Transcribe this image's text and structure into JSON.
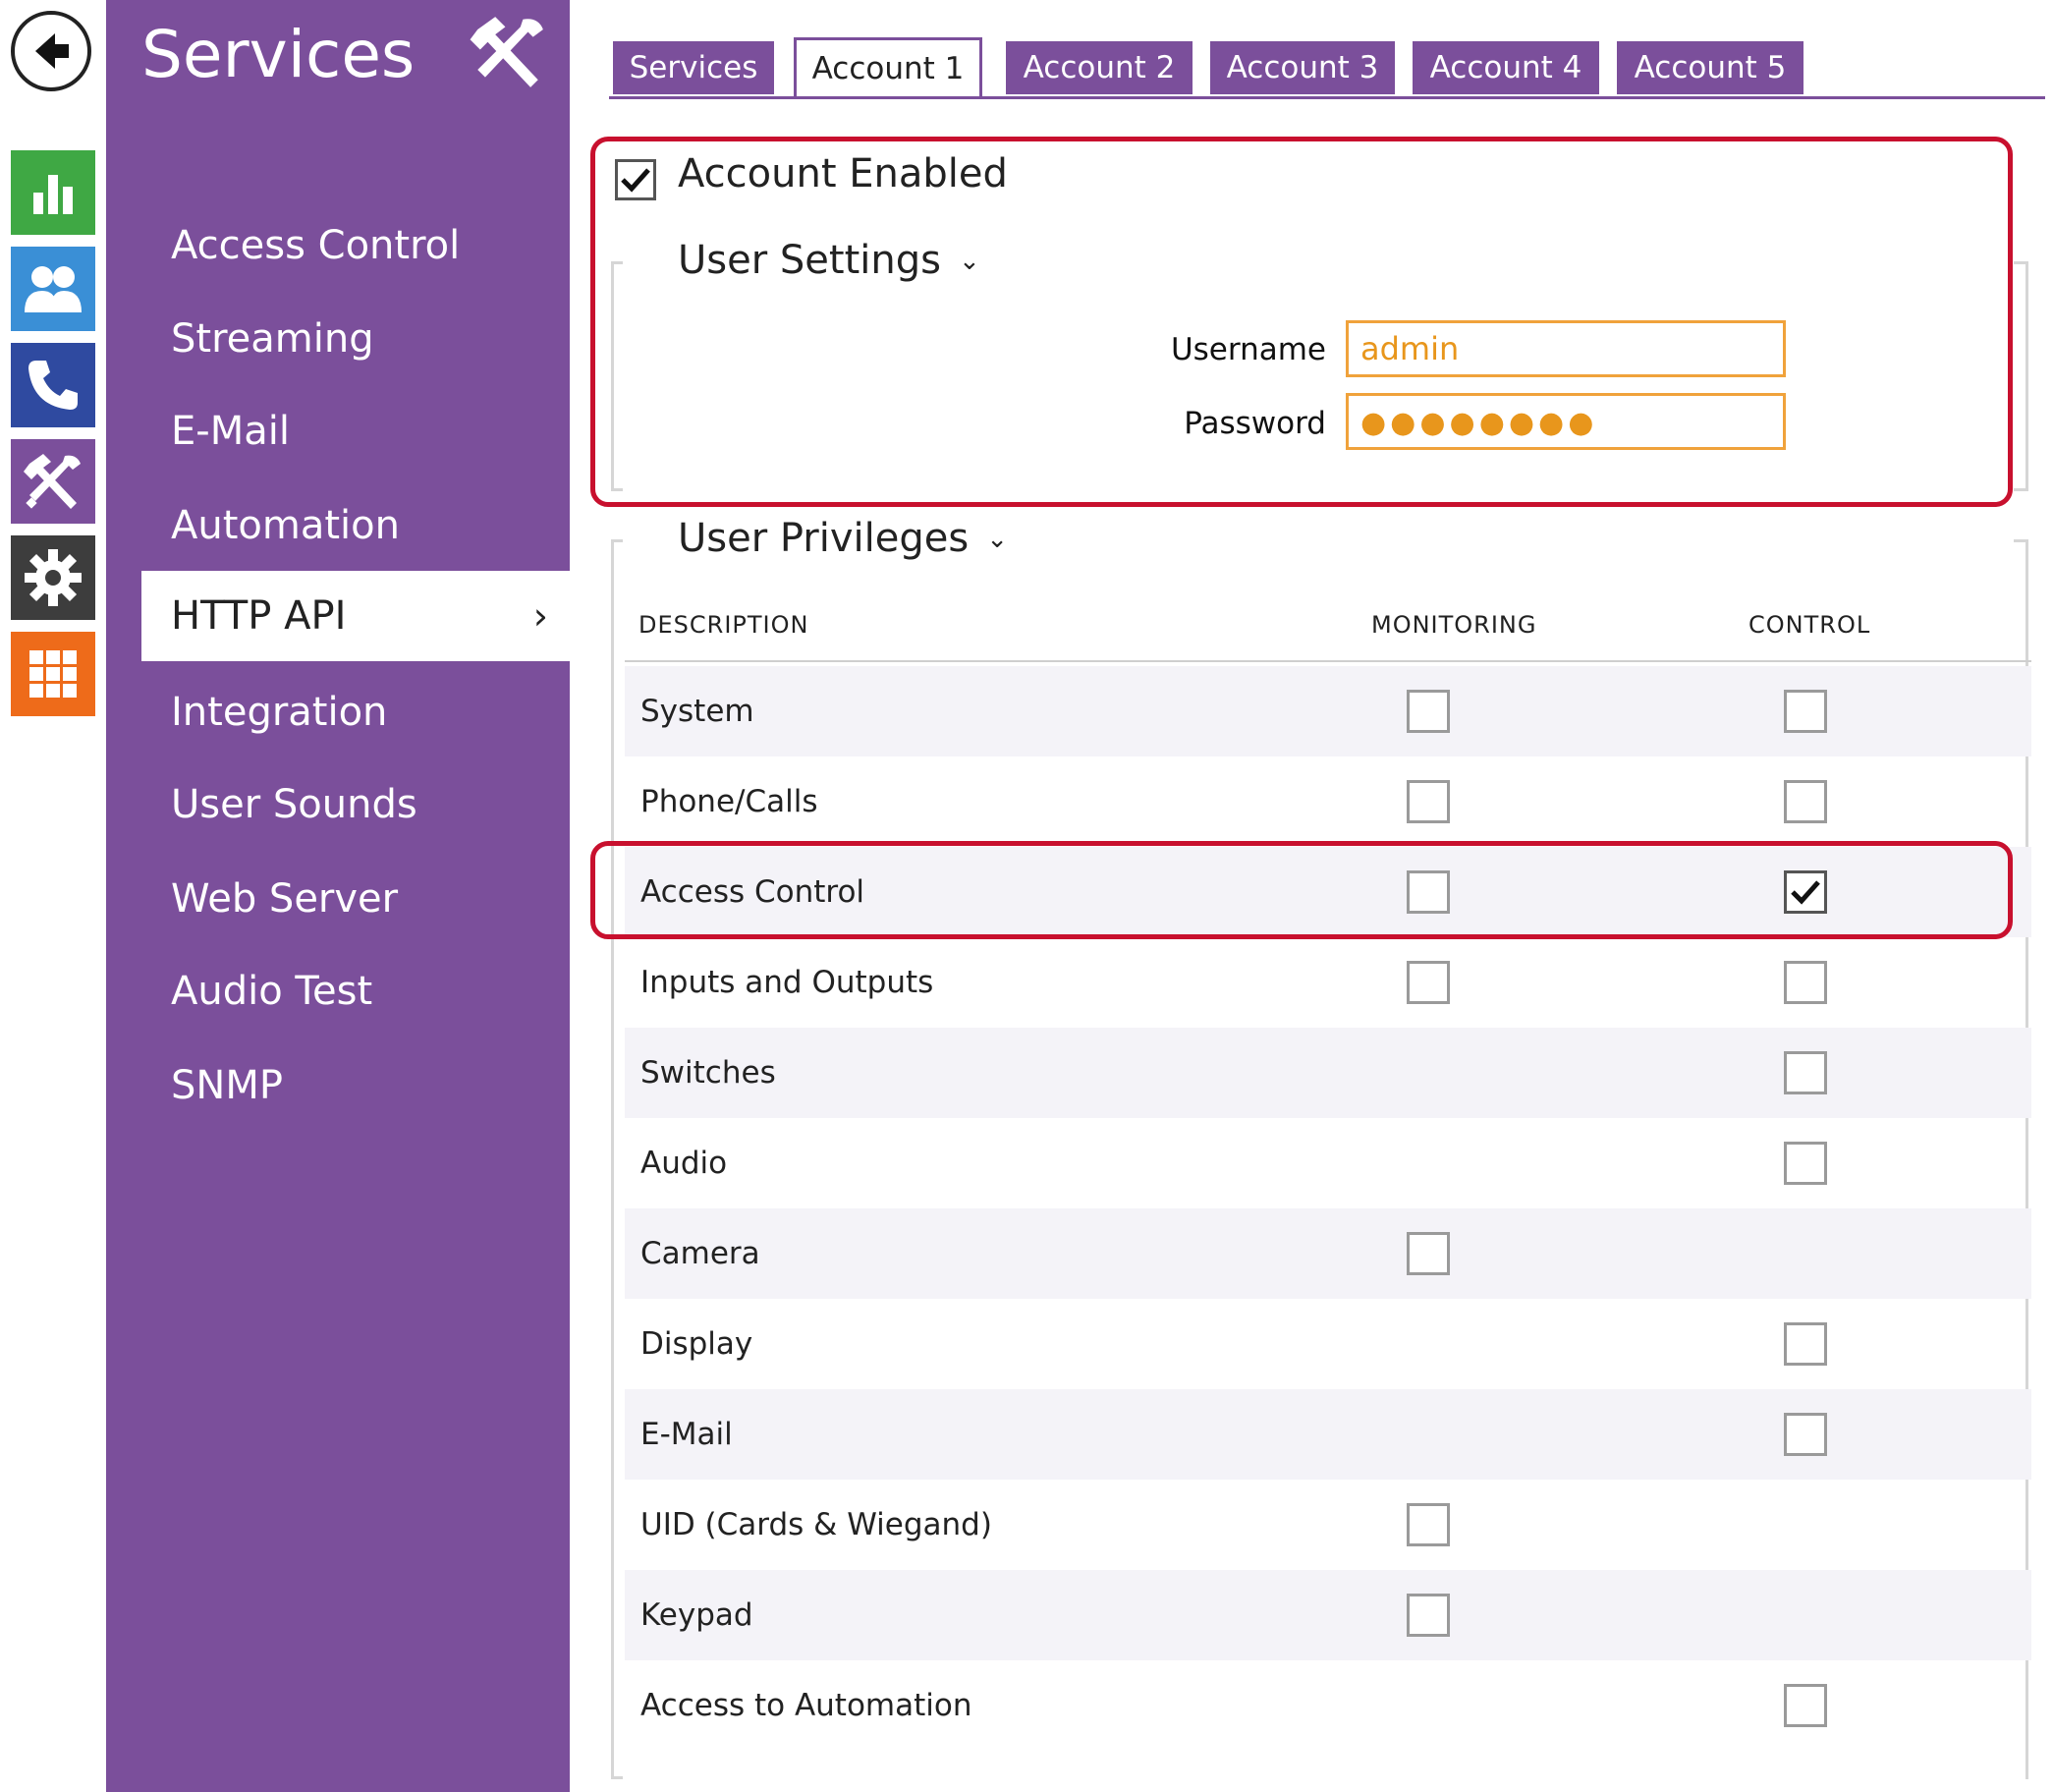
{
  "rail": {
    "items": [
      {
        "icon": "back-arrow-icon"
      },
      {
        "icon": "bar-chart-icon",
        "color": "#3fa844"
      },
      {
        "icon": "users-icon",
        "color": "#3a8fd6"
      },
      {
        "icon": "phone-icon",
        "color": "#2f4aa0"
      },
      {
        "icon": "tools-icon",
        "color": "#7b4f9b"
      },
      {
        "icon": "gear-icon",
        "color": "#3d3d3d"
      },
      {
        "icon": "grid-icon",
        "color": "#ee6b1a"
      }
    ]
  },
  "sidebar": {
    "title": "Services",
    "title_icon": "tools-icon",
    "items": [
      {
        "label": "Access Control"
      },
      {
        "label": "Streaming"
      },
      {
        "label": "E-Mail"
      },
      {
        "label": "Automation"
      },
      {
        "label": "HTTP API",
        "active": true
      },
      {
        "label": "Integration"
      },
      {
        "label": "User Sounds"
      },
      {
        "label": "Web Server"
      },
      {
        "label": "Audio Test"
      },
      {
        "label": "SNMP"
      }
    ],
    "active_chevron": "›"
  },
  "tabs": [
    {
      "label": "Services"
    },
    {
      "label": "Account 1",
      "active": true
    },
    {
      "label": "Account 2"
    },
    {
      "label": "Account 3"
    },
    {
      "label": "Account 4"
    },
    {
      "label": "Account 5"
    }
  ],
  "account": {
    "enabled_label": "Account Enabled",
    "enabled": true,
    "user_settings_title": "User Settings",
    "username_label": "Username",
    "username_value": "admin",
    "password_label": "Password",
    "password_value": "●●●●●●●●"
  },
  "privileges": {
    "title": "User Privileges",
    "headers": {
      "description": "DESCRIPTION",
      "monitoring": "MONITORING",
      "control": "CONTROL"
    },
    "rows": [
      {
        "label": "System",
        "monitoring": false,
        "control": false
      },
      {
        "label": "Phone/Calls",
        "monitoring": false,
        "control": false
      },
      {
        "label": "Access Control",
        "monitoring": false,
        "control": true
      },
      {
        "label": "Inputs and Outputs",
        "monitoring": false,
        "control": false
      },
      {
        "label": "Switches",
        "monitoring": null,
        "control": false
      },
      {
        "label": "Audio",
        "monitoring": null,
        "control": false
      },
      {
        "label": "Camera",
        "monitoring": false,
        "control": null
      },
      {
        "label": "Display",
        "monitoring": null,
        "control": false
      },
      {
        "label": "E-Mail",
        "monitoring": null,
        "control": false
      },
      {
        "label": "UID (Cards & Wiegand)",
        "monitoring": false,
        "control": null
      },
      {
        "label": "Keypad",
        "monitoring": false,
        "control": null
      },
      {
        "label": "Access to Automation",
        "monitoring": null,
        "control": false
      }
    ]
  },
  "colors": {
    "brand_purple": "#7b4f9b",
    "highlight_red": "#c8102e",
    "input_orange": "#f0a23b"
  }
}
